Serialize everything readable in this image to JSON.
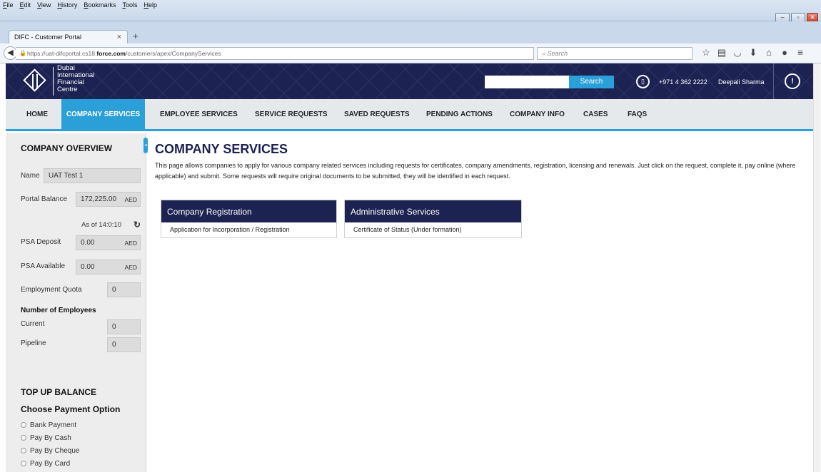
{
  "browser": {
    "menus": [
      "File",
      "Edit",
      "View",
      "History",
      "Bookmarks",
      "Tools",
      "Help"
    ],
    "tab_title": "DIFC - Customer Portal",
    "url_prefix": "https://uat-difcportal.cs18.",
    "url_domain": "force.com",
    "url_path": "/customers/apex/CompanyServices",
    "search_placeholder": "Search",
    "toolbar_icons": [
      "star-icon",
      "reading-list-icon",
      "pocket-icon",
      "download-icon",
      "home-icon",
      "chat-icon",
      "menu-icon"
    ]
  },
  "header": {
    "org_name": [
      "Dubai",
      "International",
      "Financial",
      "Centre"
    ],
    "search_button": "Search",
    "phone": "+971 4 362 2222",
    "user_name": "Deepali Sharma"
  },
  "nav": {
    "items": [
      "HOME",
      "COMPANY SERVICES",
      "EMPLOYEE SERVICES",
      "SERVICE REQUESTS",
      "SAVED REQUESTS",
      "PENDING ACTIONS",
      "COMPANY INFO",
      "CASES",
      "FAQS"
    ],
    "active": "COMPANY SERVICES"
  },
  "sidebar": {
    "title": "COMPANY OVERVIEW",
    "name_label": "Name",
    "name_value": "UAT Test 1",
    "portal_balance_label": "Portal Balance",
    "portal_balance_value": "172,225.00",
    "currency": "AED",
    "as_of": "As of 14:0:10",
    "psa_deposit_label": "PSA Deposit",
    "psa_deposit_value": "0.00",
    "psa_available_label": "PSA Available",
    "psa_available_value": "0.00",
    "employment_quota_label": "Employment Quota",
    "employment_quota_value": "0",
    "employees_heading": "Number of Employees",
    "current_label": "Current",
    "current_value": "0",
    "pipeline_label": "Pipeline",
    "pipeline_value": "0",
    "topup_title": "TOP UP BALANCE",
    "payment_heading": "Choose Payment Option",
    "payment_options": [
      "Bank Payment",
      "Pay By Cash",
      "Pay By Cheque",
      "Pay By Card"
    ]
  },
  "main": {
    "title": "COMPANY SERVICES",
    "description": "This page allows companies to apply for various company related services including requests for certificates, company amendments, registration, licensing and renewals. Just click on the request, complete it, pay online (where applicable) and submit. Some requests will require original documents to be submitted, they will be identified in each request.",
    "cards": [
      {
        "header": "Company Registration",
        "items": [
          "Application for Incorporation / Registration"
        ]
      },
      {
        "header": "Administrative Services",
        "items": [
          "Certificate of Status (Under formation)"
        ]
      }
    ]
  },
  "colors": {
    "navy": "#1c2251",
    "accent_blue": "#2a9fd8"
  }
}
